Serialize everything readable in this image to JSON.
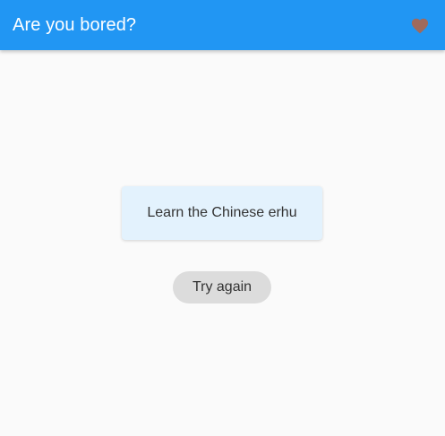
{
  "app_bar": {
    "title": "Are you bored?",
    "favorite_icon": "heart-icon",
    "favorite_icon_color": "#a06a5c",
    "background_color": "#2196f3"
  },
  "main": {
    "activity_text": "Learn the Chinese erhu",
    "card_color": "#e3f2fd",
    "try_again_label": "Try again"
  }
}
